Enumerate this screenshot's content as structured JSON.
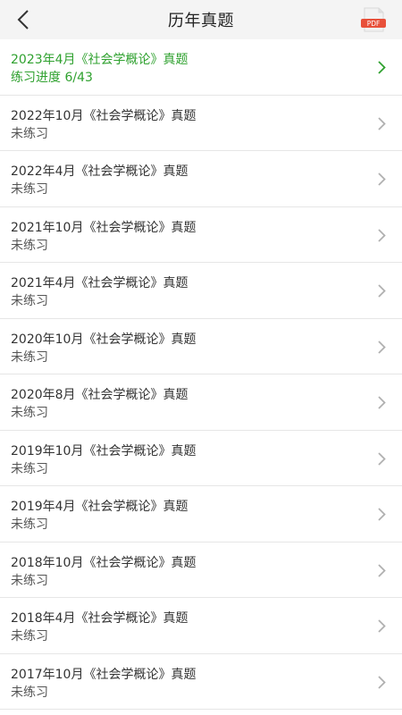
{
  "header": {
    "title": "历年真题",
    "back_icon": "chevron-left-icon",
    "pdf_icon": "pdf-file-icon",
    "pdf_label": "PDF"
  },
  "colors": {
    "accent": "#2fa12f",
    "pdf_red": "#e8503a",
    "chevron": "#b0b0b0"
  },
  "papers": [
    {
      "name": "2023年4月《社会学概论》真题",
      "status": "练习进度   6/43",
      "active": true
    },
    {
      "name": "2022年10月《社会学概论》真题",
      "status": "未练习",
      "active": false
    },
    {
      "name": "2022年4月《社会学概论》真题",
      "status": "未练习",
      "active": false
    },
    {
      "name": "2021年10月《社会学概论》真题",
      "status": "未练习",
      "active": false
    },
    {
      "name": "2021年4月《社会学概论》真题",
      "status": "未练习",
      "active": false
    },
    {
      "name": "2020年10月《社会学概论》真题",
      "status": "未练习",
      "active": false
    },
    {
      "name": "2020年8月《社会学概论》真题",
      "status": "未练习",
      "active": false
    },
    {
      "name": "2019年10月《社会学概论》真题",
      "status": "未练习",
      "active": false
    },
    {
      "name": "2019年4月《社会学概论》真题",
      "status": "未练习",
      "active": false
    },
    {
      "name": "2018年10月《社会学概论》真题",
      "status": "未练习",
      "active": false
    },
    {
      "name": "2018年4月《社会学概论》真题",
      "status": "未练习",
      "active": false
    },
    {
      "name": "2017年10月《社会学概论》真题",
      "status": "未练习",
      "active": false
    }
  ]
}
